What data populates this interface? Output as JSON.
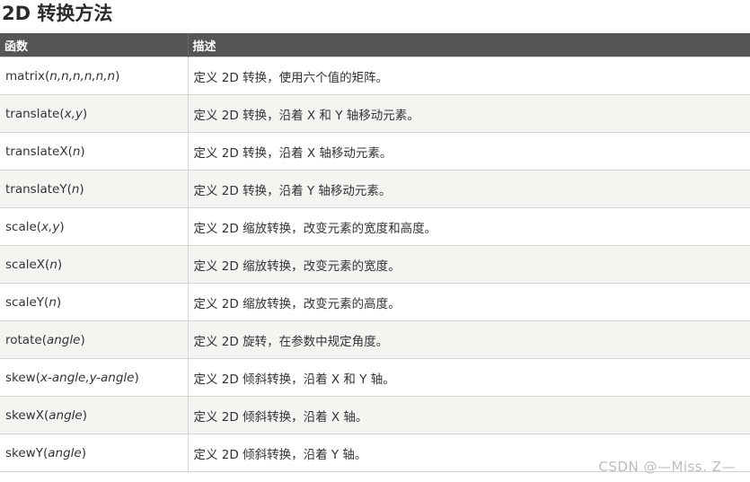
{
  "title": "2D 转换方法",
  "table": {
    "headers": [
      "函数",
      "描述"
    ],
    "rows": [
      {
        "fn": "matrix",
        "args": "n,n,n,n,n,n",
        "desc": "定义 2D 转换，使用六个值的矩阵。"
      },
      {
        "fn": "translate",
        "args": "x,y",
        "desc": "定义 2D 转换，沿着 X 和 Y 轴移动元素。"
      },
      {
        "fn": "translateX",
        "args": "n",
        "desc": "定义 2D 转换，沿着 X 轴移动元素。"
      },
      {
        "fn": "translateY",
        "args": "n",
        "desc": "定义 2D 转换，沿着 Y 轴移动元素。"
      },
      {
        "fn": "scale",
        "args": "x,y",
        "desc": "定义 2D 缩放转换，改变元素的宽度和高度。"
      },
      {
        "fn": "scaleX",
        "args": "n",
        "desc": "定义 2D 缩放转换，改变元素的宽度。"
      },
      {
        "fn": "scaleY",
        "args": "n",
        "desc": "定义 2D 缩放转换，改变元素的高度。"
      },
      {
        "fn": "rotate",
        "args": "angle",
        "desc": "定义 2D 旋转，在参数中规定角度。"
      },
      {
        "fn": "skew",
        "args": "x-angle,y-angle",
        "desc": "定义 2D 倾斜转换，沿着 X 和 Y 轴。"
      },
      {
        "fn": "skewX",
        "args": "angle",
        "desc": "定义 2D 倾斜转换，沿着 X 轴。"
      },
      {
        "fn": "skewY",
        "args": "angle",
        "desc": "定义 2D 倾斜转换，沿着 Y 轴。"
      }
    ]
  },
  "watermark": "CSDN @—Miss. Z—"
}
